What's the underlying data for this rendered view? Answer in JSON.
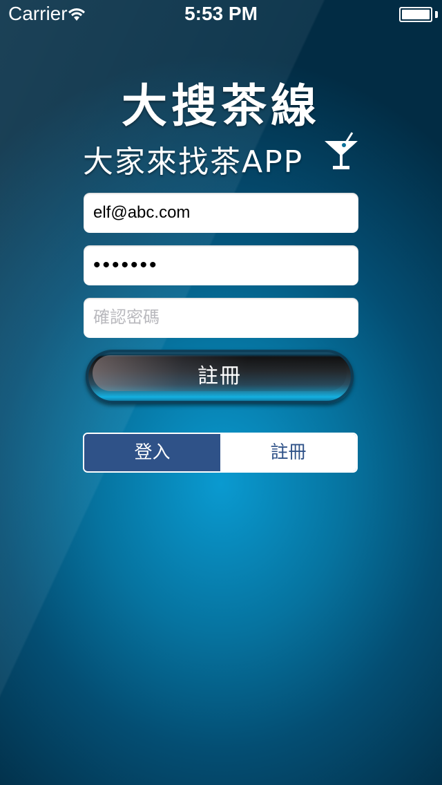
{
  "status_bar": {
    "carrier": "Carrier",
    "time": "5:53 PM"
  },
  "header": {
    "title": "大搜茶線",
    "subtitle": "大家來找茶APP",
    "icon": "cocktail-glass-icon"
  },
  "form": {
    "email_value": "elf@abc.com",
    "password_value": "•••••••",
    "confirm_placeholder": "確認密碼",
    "submit_label": "註冊"
  },
  "segment": {
    "options": [
      "登入",
      "註冊"
    ],
    "selected": "登入"
  },
  "colors": {
    "segment_accent": "#2f5288",
    "background": "#06739f"
  }
}
